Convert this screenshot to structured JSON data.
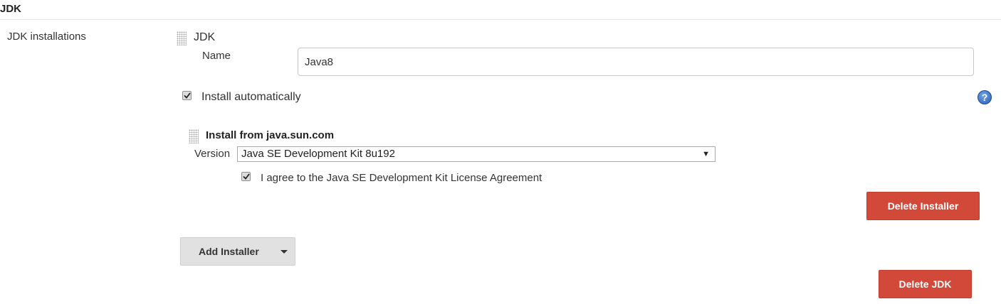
{
  "section": {
    "title": "JDK"
  },
  "field": {
    "label": "JDK installations"
  },
  "jdk": {
    "heading": "JDK",
    "name_label": "Name",
    "name_value": "Java8",
    "install_auto_label": "Install automatically",
    "install_auto_checked": true,
    "help_glyph": "?"
  },
  "installer": {
    "heading": "Install from java.sun.com",
    "version_label": "Version",
    "version_selected": "Java SE Development Kit 8u192",
    "dropdown_glyph": "▼",
    "agree_label": "I agree to the Java SE Development Kit License Agreement",
    "agree_checked": true,
    "delete_installer_label": "Delete Installer"
  },
  "actions": {
    "add_installer_label": "Add Installer",
    "delete_jdk_label": "Delete JDK"
  },
  "colors": {
    "danger": "#d24939",
    "neutral_button": "#e1e1e1",
    "help_icon": "#2b5fb4"
  }
}
